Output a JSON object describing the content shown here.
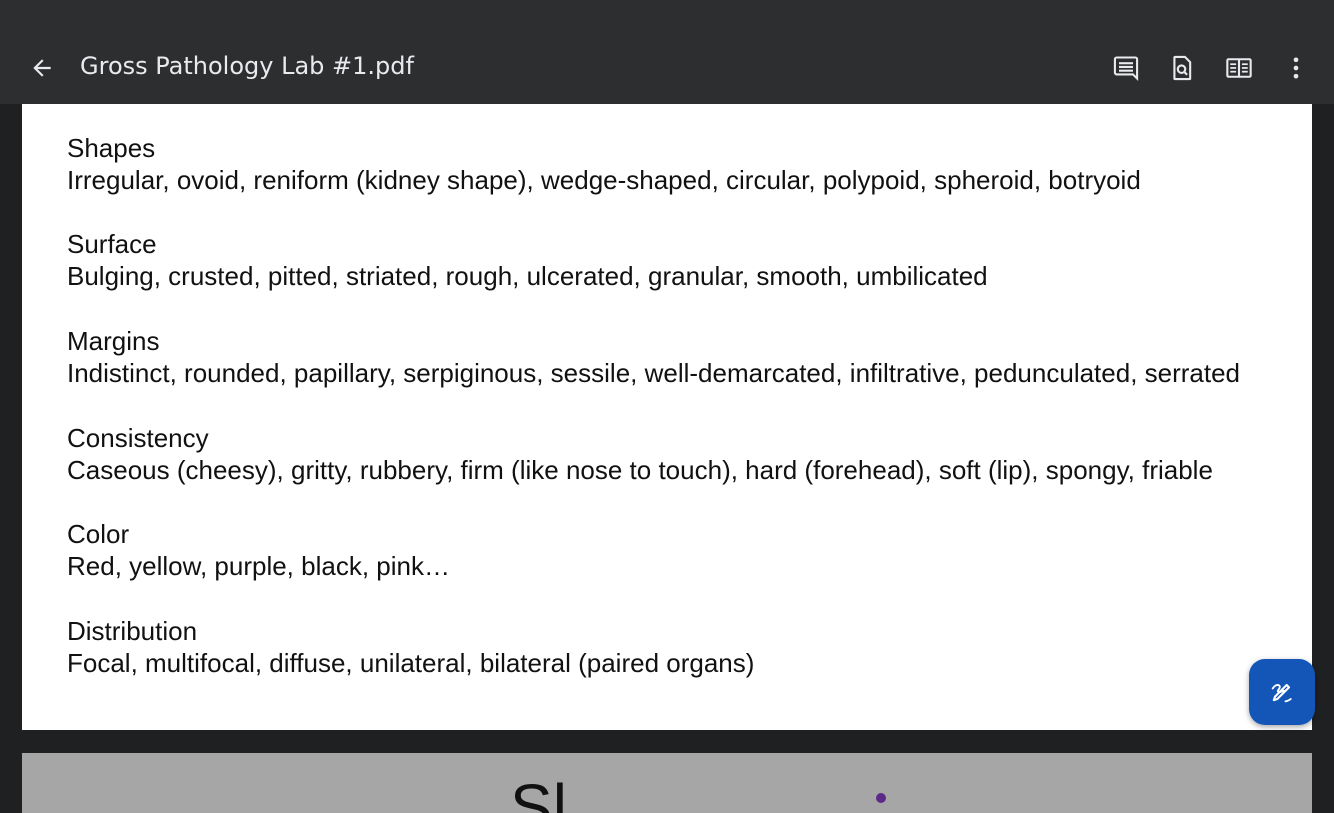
{
  "app_bar": {
    "title": "Gross Pathology Lab #1.pdf",
    "back_icon": "arrow-back-icon",
    "actions": [
      {
        "name": "comments-button",
        "icon": "comment-icon"
      },
      {
        "name": "find-in-document-button",
        "icon": "search-document-icon"
      },
      {
        "name": "reading-mode-button",
        "icon": "book-view-icon"
      },
      {
        "name": "more-options-button",
        "icon": "more-vert-icon"
      }
    ]
  },
  "document": {
    "sections": [
      {
        "heading": "Shapes",
        "body": "Irregular, ovoid, reniform (kidney shape), wedge-shaped, circular, polypoid, spheroid, botryoid"
      },
      {
        "heading": "Surface",
        "body": "Bulging, crusted, pitted, striated, rough, ulcerated, granular, smooth, umbilicated"
      },
      {
        "heading": "Margins",
        "body": "Indistinct, rounded, papillary, serpiginous, sessile, well-demarcated, infiltrative, pedunculated, serrated"
      },
      {
        "heading": "Consistency",
        "body": "Caseous (cheesy), gritty, rubbery, firm (like nose to touch), hard (forehead), soft (lip), spongy, friable"
      },
      {
        "heading": "Color",
        "body": "Red, yellow, purple, black, pink…"
      },
      {
        "heading": "Distribution",
        "body": "Focal, multifocal, diffuse, unilateral, bilateral (paired organs)"
      }
    ],
    "next_page_partial_text": "Sl"
  },
  "fab": {
    "icon": "annotate-pen-icon"
  },
  "colors": {
    "app_bar_bg": "#2d2e30",
    "viewer_bg": "#1f2022",
    "page_bg": "#ffffff",
    "fab_bg": "#1456b8",
    "title_text": "#e8eaed"
  }
}
